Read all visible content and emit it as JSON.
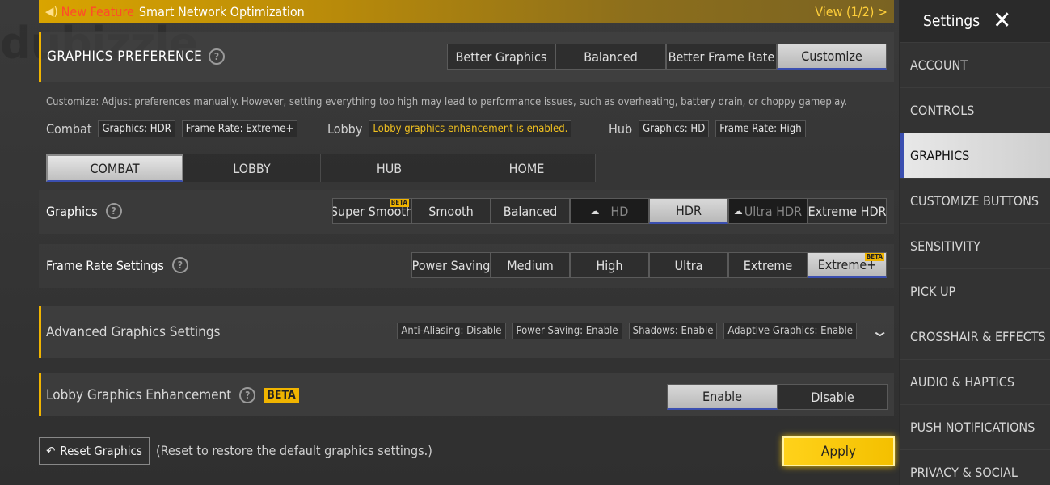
{
  "banner": {
    "new_feature": "New Feature",
    "title": "Smart Network Optimization",
    "view": "View (1/2) >"
  },
  "watermark": "dubizzle",
  "preference": {
    "title": "GRAPHICS PREFERENCE",
    "options": [
      "Better Graphics",
      "Balanced",
      "Better Frame Rate",
      "Customize"
    ],
    "selected": "Customize",
    "description": "Customize: Adjust preferences manually. However, setting everything too high may lead to performance issues, such as overheating, battery drain, or choppy gameplay."
  },
  "status": {
    "combat_label": "Combat",
    "combat_graphics": "Graphics: HDR",
    "combat_fps": "Frame Rate: Extreme+",
    "lobby_label": "Lobby",
    "lobby_text": "Lobby graphics enhancement is enabled.",
    "hub_label": "Hub",
    "hub_graphics": "Graphics: HD",
    "hub_fps": "Frame Rate: High"
  },
  "tabs": [
    "COMBAT",
    "LOBBY",
    "HUB",
    "HOME"
  ],
  "graphics": {
    "label": "Graphics",
    "options": [
      "Super Smooth",
      "Smooth",
      "Balanced",
      "HD",
      "HDR",
      "Ultra HDR",
      "Extreme HDR"
    ],
    "selected": "HDR",
    "beta_tag": "BETA"
  },
  "frame_rate": {
    "label": "Frame Rate Settings",
    "options": [
      "Power Saving",
      "Medium",
      "High",
      "Ultra",
      "Extreme",
      "Extreme+"
    ],
    "selected": "Extreme+",
    "beta_tag": "BETA"
  },
  "advanced": {
    "label": "Advanced Graphics Settings",
    "chips": [
      "Anti-Aliasing: Disable",
      "Power Saving: Enable",
      "Shadows: Enable",
      "Adaptive Graphics: Enable"
    ]
  },
  "lobby_enh": {
    "label": "Lobby Graphics Enhancement",
    "badge": "BETA",
    "enable": "Enable",
    "disable": "Disable"
  },
  "footer": {
    "reset": "Reset Graphics",
    "note": "(Reset to restore the default graphics settings.)",
    "apply": "Apply"
  },
  "sidebar": {
    "title": "Settings",
    "items": [
      "ACCOUNT",
      "CONTROLS",
      "GRAPHICS",
      "CUSTOMIZE BUTTONS",
      "SENSITIVITY",
      "PICK UP",
      "CROSSHAIR & EFFECTS",
      "AUDIO & HAPTICS",
      "PUSH NOTIFICATIONS",
      "PRIVACY & SOCIAL"
    ],
    "selected": "GRAPHICS"
  },
  "colors": {
    "accent": "#f0b400",
    "selected_underline": "#3b4fb0",
    "apply": "#ffd21a"
  }
}
